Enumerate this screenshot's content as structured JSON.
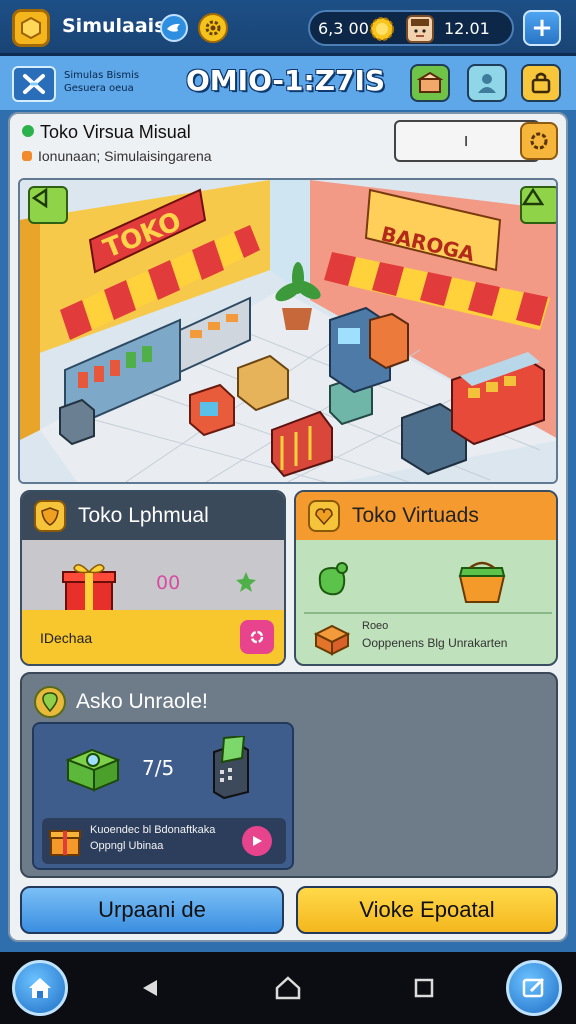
{
  "topbar": {
    "app_name": "Simulaais",
    "coins": "6,3 00",
    "gems": "12.01",
    "plus_label": "+"
  },
  "header": {
    "subtitle_line1": "Simulas Bismis",
    "subtitle_line2": "Gesuera oeua",
    "code": "OMIO-1:Z7IS"
  },
  "shop": {
    "title": "Toko Virsua Misual",
    "subtitle": "Ionunaan; Simulaisingarena",
    "counter_value": "I",
    "sign_left": "TOKO",
    "sign_right": "BAROGA"
  },
  "card_left": {
    "title": "Toko Lphmual",
    "count": "00",
    "footer_label": "IDechaa"
  },
  "card_right": {
    "title": "Toko Virtuads",
    "footer_title": "Roeo",
    "footer_desc": "Ooppenens Blg Unrakarten"
  },
  "upgrade": {
    "title": "Asko Unraole!",
    "ratio": "7/5",
    "row_title": "Kuoendec bl Bdonaftkaka",
    "row_desc": "Oppngl Ubinaa"
  },
  "actions": {
    "left": "Urpaani de",
    "right": "Vioke Epoatal"
  },
  "colors": {
    "accent_blue": "#5ea7e8",
    "accent_yellow": "#f8c72d",
    "accent_orange": "#f59a2f",
    "accent_pink": "#e8448d"
  }
}
